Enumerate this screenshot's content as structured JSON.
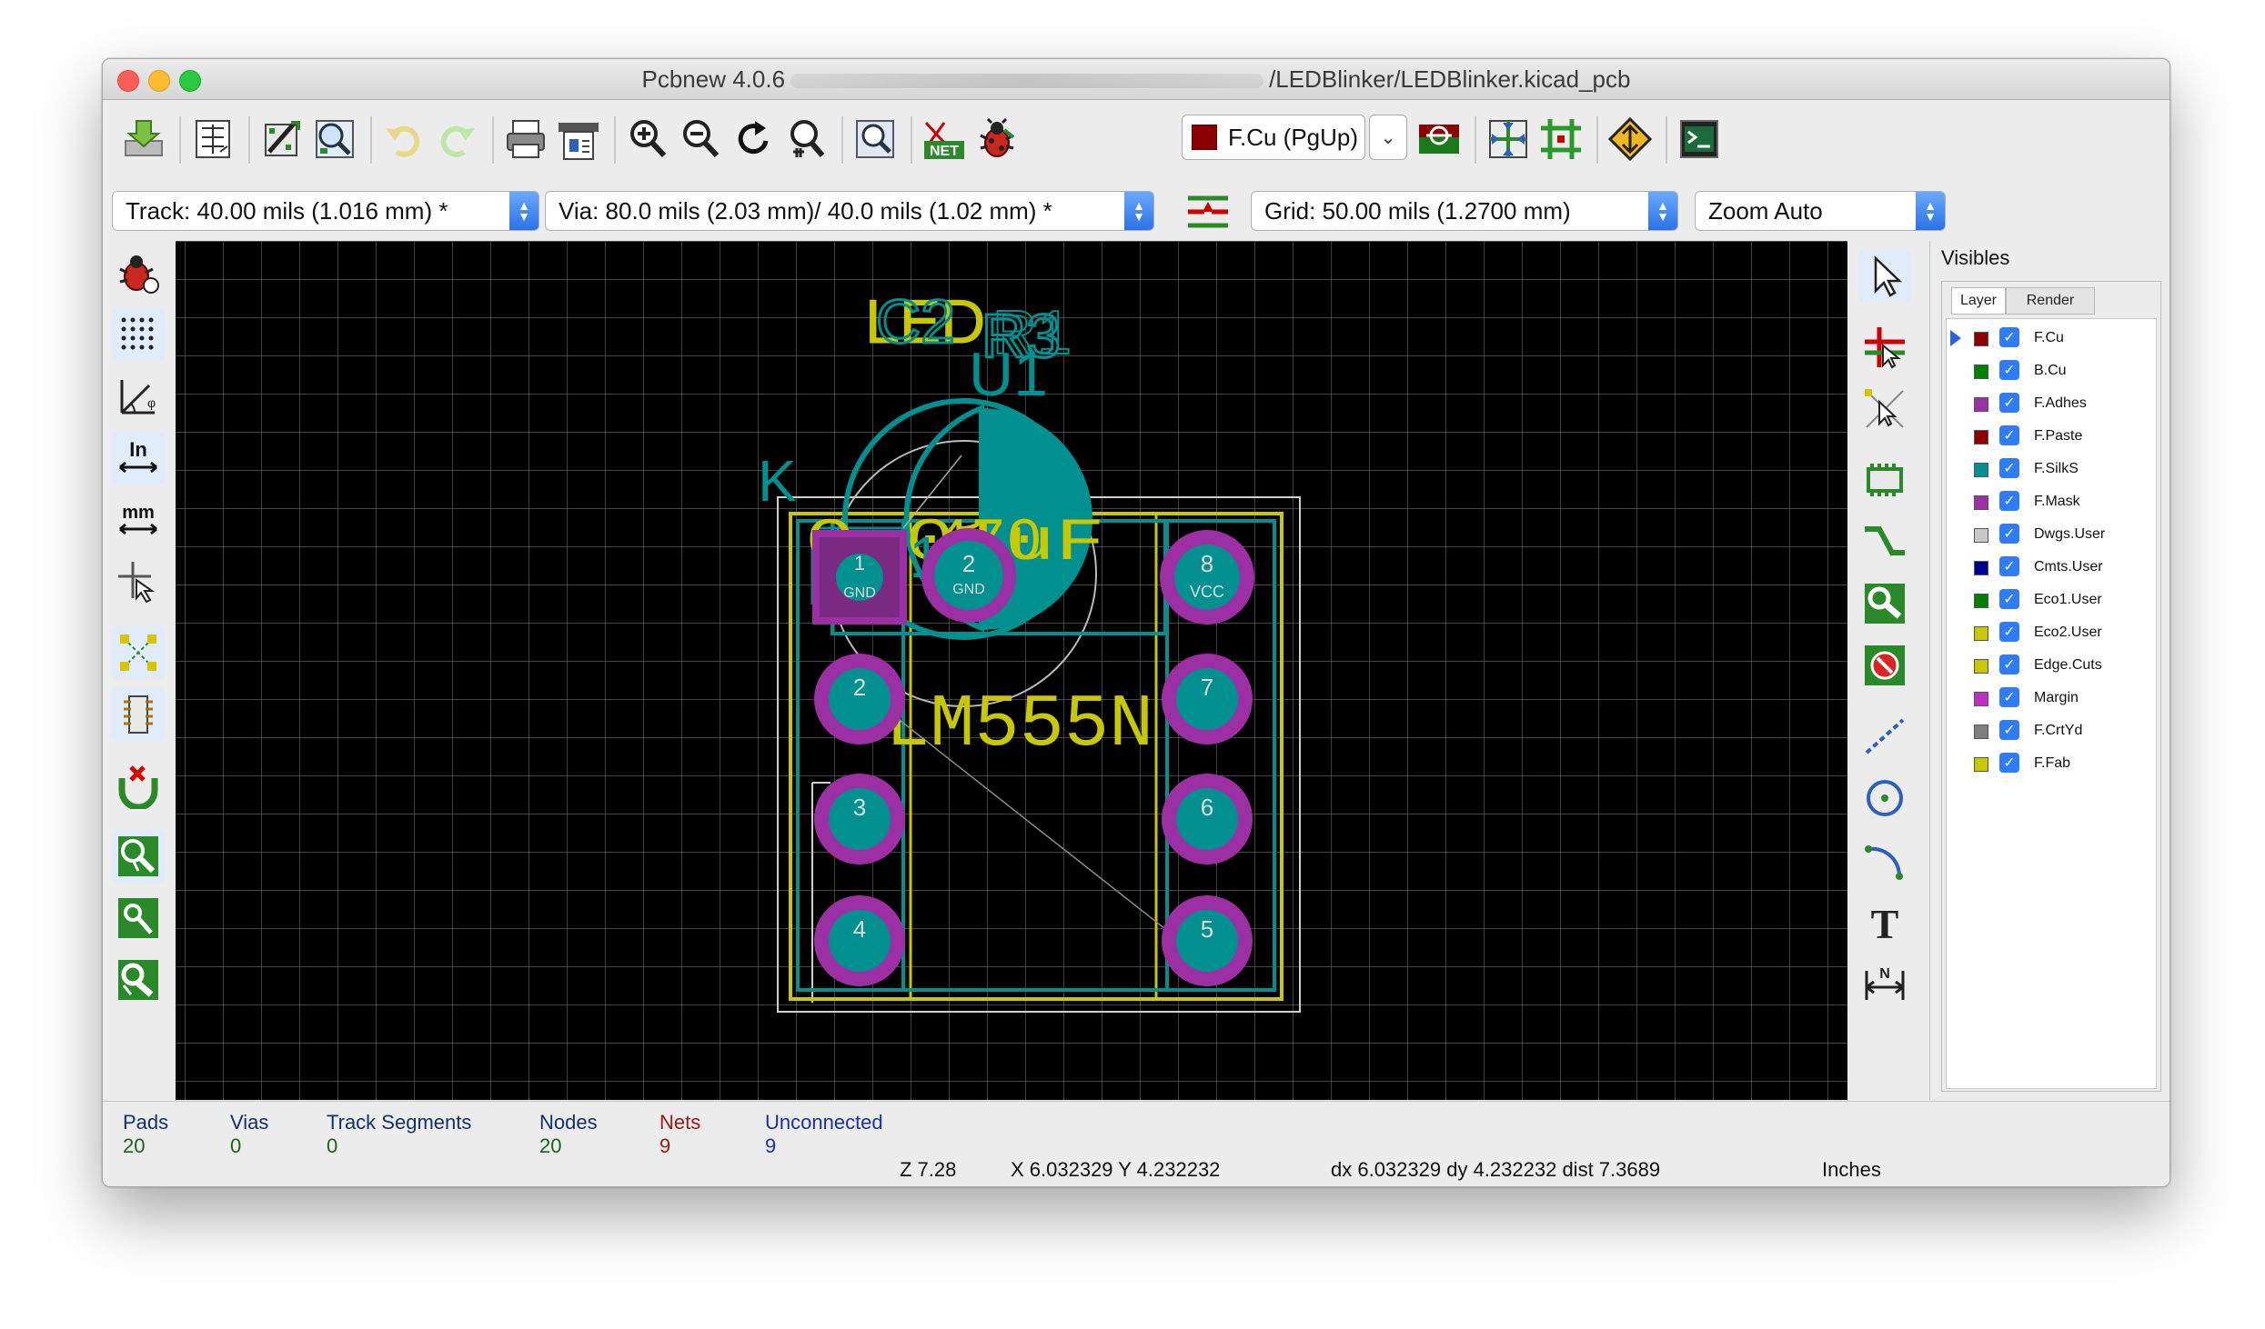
{
  "window": {
    "title_left": "Pcbnew 4.0.6",
    "title_right": "/LEDBlinker/LEDBlinker.kicad_pcb"
  },
  "toolbar": {
    "icons": [
      "save-board-icon",
      "page-settings-icon",
      "module-editor-icon",
      "footprint-browser-icon",
      "undo-icon",
      "redo-icon",
      "print-icon",
      "plot-icon",
      "zoom-in-icon",
      "zoom-out-icon",
      "redraw-icon",
      "zoom-fit-icon",
      "find-icon",
      "netlist-icon",
      "drc-icon",
      "layer-pair-icon",
      "autoroute-icon",
      "microwave-icon",
      "show-pcb-icon",
      "scripting-console-icon"
    ],
    "active_layer": "F.Cu (PgUp)",
    "active_layer_color": "#8b0000"
  },
  "options_bar": {
    "track": "Track: 40.00 mils (1.016 mm) *",
    "via": "Via: 80.0 mils (2.03 mm)/ 40.0 mils (1.02 mm) *",
    "grid": "Grid: 50.00 mils (1.2700 mm)",
    "zoom": "Zoom Auto"
  },
  "pcb": {
    "labels": {
      "led": "LED",
      "c2": "C2",
      "r3": "R3",
      "r1": "R1",
      "u1": "U1",
      "k": "K",
      "overlap_values": "0.01uF",
      "overlap_values2": "470",
      "lm555n": "LM555N",
      "u1_lower": "U1"
    },
    "pads": [
      "1",
      "2",
      "3",
      "4",
      "5",
      "6",
      "7",
      "8"
    ],
    "led_pads": [
      "1",
      "2"
    ],
    "pad_nets": {
      "p1": "GND",
      "led2": "GND",
      "p8": "VCC"
    }
  },
  "visibles": {
    "title": "Visibles",
    "tabs": [
      "Layer",
      "Render"
    ],
    "layers": [
      {
        "name": "F.Cu",
        "color": "#8b0000",
        "checked": true,
        "active": true
      },
      {
        "name": "B.Cu",
        "color": "#008000",
        "checked": true
      },
      {
        "name": "F.Adhes",
        "color": "#9c2fa3",
        "checked": true
      },
      {
        "name": "F.Paste",
        "color": "#8b0000",
        "checked": true
      },
      {
        "name": "F.SilkS",
        "color": "#00908f",
        "checked": true
      },
      {
        "name": "F.Mask",
        "color": "#9c2fa3",
        "checked": true
      },
      {
        "name": "Dwgs.User",
        "color": "#c8c8c8",
        "checked": true
      },
      {
        "name": "Cmts.User",
        "color": "#000090",
        "checked": true
      },
      {
        "name": "Eco1.User",
        "color": "#008000",
        "checked": true
      },
      {
        "name": "Eco2.User",
        "color": "#c8c800",
        "checked": true
      },
      {
        "name": "Edge.Cuts",
        "color": "#c8c800",
        "checked": true
      },
      {
        "name": "Margin",
        "color": "#c030c0",
        "checked": true
      },
      {
        "name": "F.CrtYd",
        "color": "#808080",
        "checked": true
      },
      {
        "name": "F.Fab",
        "color": "#c8c800",
        "checked": true
      }
    ]
  },
  "status": {
    "pads_label": "Pads",
    "pads": "20",
    "vias_label": "Vias",
    "vias": "0",
    "segments_label": "Track Segments",
    "segments": "0",
    "nodes_label": "Nodes",
    "nodes": "20",
    "nets_label": "Nets",
    "nets": "9",
    "unconnected_label": "Unconnected",
    "unconnected": "9",
    "zoom": "Z 7.28",
    "xy": "X 6.032329  Y 4.232232",
    "delta": "dx 6.032329  dy 4.232232  dist 7.3689",
    "units": "Inches"
  }
}
